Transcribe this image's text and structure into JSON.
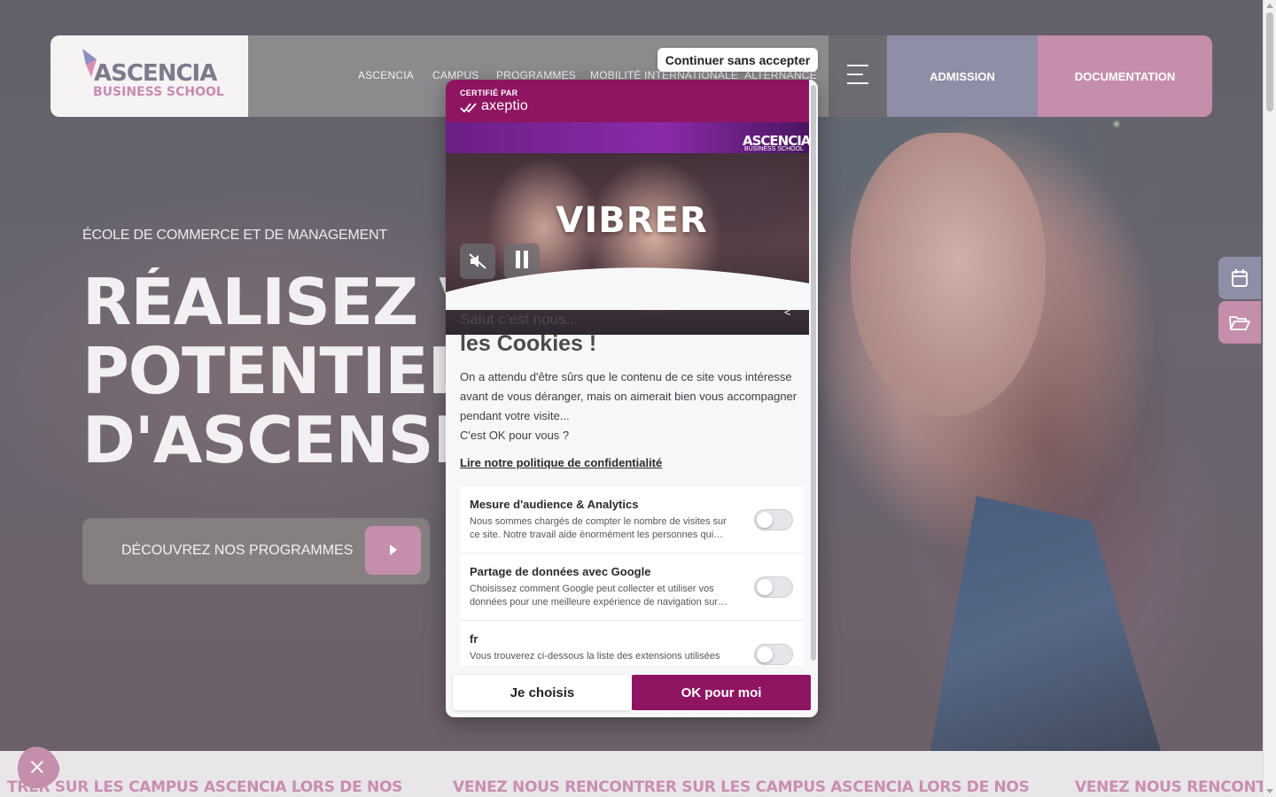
{
  "header": {
    "logo_main": "ASCENCIA",
    "logo_sub": "BUSINESS SCHOOL",
    "nav": [
      "ASCENCIA",
      "CAMPUS",
      "PROGRAMMES",
      "MOBILITÉ INTERNATIONALE",
      "ALTERNANCE"
    ],
    "admission_label": "ADMISSION",
    "documentation_label": "DOCUMENTATION"
  },
  "hero": {
    "kicker": "ÉCOLE DE COMMERCE ET DE MANAGEMENT",
    "title_lines": [
      "RÉALISEZ V",
      "POTENTIEL",
      "D'ASCENSI"
    ],
    "cta_label": "DÉCOUVREZ NOS PROGRAMMES"
  },
  "ticker": {
    "segments": [
      "TRER SUR LES CAMPUS ASCENCIA LORS DE NOS",
      "VENEZ NOUS RENCONTRER SUR LES CAMPUS ASCENCIA LORS DE NOS",
      "VENEZ NOUS RENCONT"
    ]
  },
  "cookie": {
    "continue_label": "Continuer sans accepter",
    "certified_label": "CERTIFIÉ PAR",
    "certifier": "axeptio",
    "video_text": "VIBRER",
    "video_logo": "ASCENCIA",
    "video_logo_sub": "BUSINESS SCHOOL",
    "collapse_glyph": "<",
    "greeting_small": "Salut c'est nous...",
    "greeting_big": "les Cookies !",
    "intro": "On a attendu d'être sûrs que le contenu de ce site vous intéresse avant de vous déranger, mais on aimerait bien vous accompagner pendant votre visite...",
    "intro_question": "C'est OK pour vous ?",
    "policy_link": "Lire notre politique de confidentialité",
    "purposes": [
      {
        "title": "Mesure d'audience & Analytics",
        "desc": "Nous sommes chargés de compter le nombre de visites sur ce site. Notre travail aide énormément les personnes qui…",
        "enabled": false
      },
      {
        "title": "Partage de données avec Google",
        "desc": "Choisissez comment Google peut collecter et utiliser vos données pour une meilleure expérience de navigation sur…",
        "enabled": false
      },
      {
        "title": "fr",
        "desc": "Vous trouverez ci-dessous la liste des extensions utilisées sur",
        "enabled": false
      }
    ],
    "choose_label": "Je choisis",
    "ok_label": "OK pour moi"
  },
  "colors": {
    "axeptio_brand": "#8f1461",
    "accent_pink": "#c58eac",
    "accent_lilac": "#8e8ea6"
  },
  "icons": {
    "menu": "hamburger-icon",
    "calendar": "calendar-icon",
    "folder": "folder-open-icon",
    "mute": "muted-speaker-icon",
    "pause": "pause-icon",
    "close": "close-icon"
  }
}
